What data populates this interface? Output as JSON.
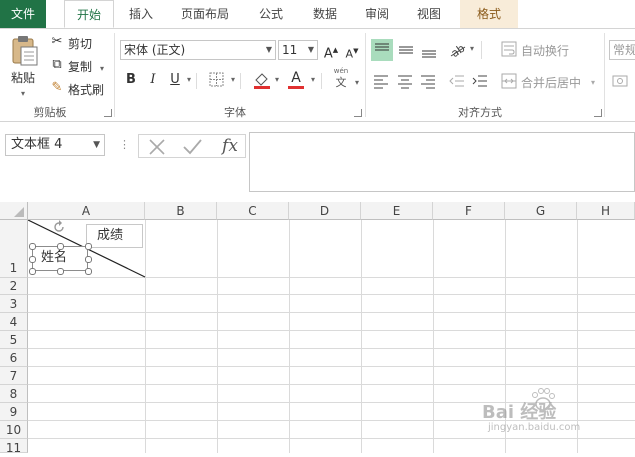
{
  "tabs": [
    "文件",
    "开始",
    "插入",
    "页面布局",
    "公式",
    "数据",
    "审阅",
    "视图",
    "格式"
  ],
  "ribbon": {
    "clipboard": {
      "paste": "粘贴",
      "cut": "剪切",
      "copy": "复制",
      "format_painter": "格式刷",
      "group_label": "剪贴板"
    },
    "font": {
      "font_name": "宋体 (正文)",
      "font_size": "11",
      "bold": "B",
      "italic": "I",
      "underline": "U",
      "font_color_glyph": "A",
      "wen_top": "wén",
      "wen_bottom": "文",
      "group_label": "字体"
    },
    "alignment": {
      "wrap_text": "自动换行",
      "merge_center": "合并后居中",
      "group_label": "对齐方式"
    },
    "number": {
      "format_value": "常规"
    }
  },
  "formula_bar": {
    "name_box": "文本框 4",
    "fx": "fx",
    "formula_value": ""
  },
  "columns": [
    "A",
    "B",
    "C",
    "D",
    "E",
    "F",
    "G",
    "H"
  ],
  "rows": [
    "1",
    "2",
    "3",
    "4",
    "5",
    "6",
    "7",
    "8",
    "9",
    "10",
    "11"
  ],
  "textboxes": {
    "score": "成绩",
    "name": "姓名"
  },
  "watermark": {
    "brand": "Bai 经验",
    "url": "jingyan.baidu.com"
  },
  "colors": {
    "accent": "#217346",
    "format_tab": "#f8ecd9",
    "align_active": "#a9dcbd",
    "font_color": "#e03030"
  }
}
